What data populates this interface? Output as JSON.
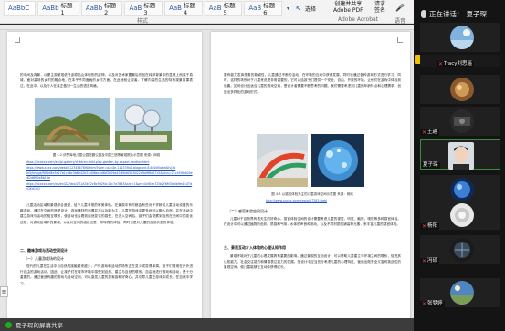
{
  "ribbon": {
    "styles": [
      {
        "label": "",
        "preview": "AaBbC"
      },
      {
        "label": "标题 1",
        "preview": "AaBb"
      },
      {
        "label": "标题 2",
        "preview": "AaBb"
      },
      {
        "label": "标题 3",
        "preview": "AaB"
      },
      {
        "label": "标题 4",
        "preview": "AaB"
      },
      {
        "label": "标题 5",
        "preview": "AaB"
      },
      {
        "label": "标题 6",
        "preview": "AaB"
      }
    ],
    "group_style": "样式",
    "select_label": "选择",
    "create_pdf": "创建并共享\nAdobe PDF",
    "request_sign": "请求\n签名",
    "voice": "语音",
    "adobe_group": "Adobe Acrobat",
    "voice_group": "语音"
  },
  "left_page": {
    "para1": "的中间及背景，以便主观景观依托该原始山体地形的延伸，以及对艺术家置景后作品在纯粹背景中的显现上而高于真城，面对高场的乡村的融合地，在本乎不同面画的乡村方面，在此地就让观者。了解内容的生活的特有观景效果表达，在此中，以及行人在真正做到一生活的语言风格。",
    "caption1": "图 4.2  伊罗库地儿童公园花瓣公园及中国三馆等景观照片示意图  来源：网络",
    "links": [
      "https://xxxxxx.com/en/pi-gallery/children-wild-play-garden-by-aspect-studios.html",
      "https://www.xxxx.com/detail/1234567890.html?spm=a2c4e.11153940.blogcont.8.6e0d5a8eAlIvj3b",
      "5e5/image/f0f0e8e3e27b1c66c3b6e42b31d06ec4d6d3b09a45f80d05b3b22d9a9f6d27c5&plus=21c4f3f0d09ec62d6ff0e8b16e",
      "https://xxxxxx.com/cn/en/ZZ/doc/ZZ1A3b72c8c9d2f4c16c7a7893&src=1&pn=0cKfac7Zlb2Y6M3dalb9e4c1JTdyQXd1SQ"
    ],
    "para2": "儿童活动区域和景观综合造型，给予儿童非常的审美体验。在景观中有时都会有些对于学龄前儿童活动设置的乐趣游戏。通过在空间的造型设计，游戏器材的布置并不以功能为主，儿童在游戏中更多地可以融入自然，并在活动中建立游戏与活动的相互联系，使活动也会看到自然变化的感受，在进入空间后，孩子们会觉察到自然在空间中的变化过程，对游戏区域中的景观，以及对空间的组织也是一种特殊的体验，同时也是对儿童的自然状态的体验。",
    "heading": "二、趣味游戏与活动空间设计",
    "subheading": "（一）儿童游戏场的设计",
    "para3": "现代的儿童在生活中与自然的接触越来越少，户外游戏和活动的场所正在变少或变得单调，孩子们很难在户外进行自由的游戏活动。因此，让孩子们在城市环境中感受到自然、建立与自然的联系，自由地进行游戏和活动，是十分重要的。通过营造有趣的游戏与活动空间，可以激发儿童的探索欲和好奇心，并引导儿童在游戏中成长，在自然中学习。"
  },
  "right_page": {
    "para1": "要有能力发挥想象的新颖性，儿童通过不断的活动，在环境的互动中获得发展，同时也通过各种游戏形式进行学习。同时，这样的场所对于儿童来说是非常重要的，它可以给孩子们提供一个安全、自由、开放的环境，让他们在游戏中体验到乐趣。如何设计出适合儿童的游戏空间，是设计者需要不断思考的问题。我们需要考虑到儿童的年龄特点和心理需求，创造出多样化的游戏形式。",
    "caption": "图 4.3  以感知体验为主的儿童游戏空间示意图  来源：网络",
    "link": "http://www.xxxxx.com/ceo/a/17283.html",
    "subheading": "（二）感官体验空间设计",
    "para2": "儿童对于自然界有着天生的好奇心，感官体验空间的设计需要考虑儿童的视觉、听觉、触觉、嗅觉等多种感官体验。在设计中可以通过植物的色彩、质感和气味，水体的声音和流动，以及不同材质的铺装等元素，来丰富儿童的感官体验。",
    "heading": "三、景观互动介入体验的心理认知作用",
    "para3": "景观环境对于儿童的心理发展具有重要的影响。通过景观的互动设计，可以帮助儿童建立与环境之间的联系，促进其认知能力、社会交往能力和情感表达能力的发展。在设计中应当充分考虑儿童的心理特征，营造出既安全又富有挑战性的景观空间，使儿童能够在互动中获得成长。"
  },
  "status": {
    "sharing_text": "夏子琛的屏幕共享",
    "zoom": "100%"
  },
  "panel": {
    "speaking_label": "正在讲话：",
    "speaking_name": "夏子琛",
    "participants": [
      {
        "name": "",
        "muted": false,
        "avatar": "blue-sky"
      },
      {
        "name": "Tracy刘思遥",
        "muted": true,
        "avatar": "none"
      },
      {
        "name": "",
        "muted": false,
        "avatar": "brown-food"
      },
      {
        "name": "王越",
        "muted": true,
        "avatar": "dark-photo"
      },
      {
        "name": "夏子琛",
        "muted": false,
        "avatar": "face"
      },
      {
        "name": "",
        "muted": false,
        "avatar": "blue-orb"
      },
      {
        "name": "杨阳",
        "muted": true,
        "avatar": "white-round"
      },
      {
        "name": "冯硕",
        "muted": true,
        "avatar": "dark-globe"
      },
      {
        "name": "张梦婷",
        "muted": true,
        "avatar": "blue-landscape"
      }
    ]
  }
}
